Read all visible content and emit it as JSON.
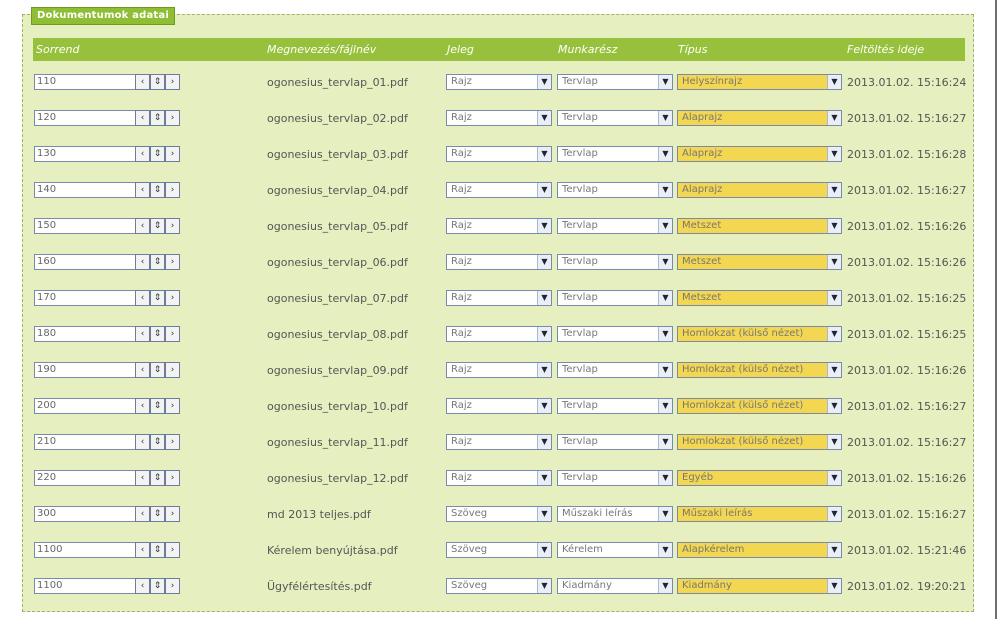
{
  "legend": "Dokumentumok adatai",
  "header": {
    "order": "Sorrend",
    "name": "Megnevezés/fájlnév",
    "mark": "Jeleg",
    "work": "Munkarész",
    "type": "Típus",
    "upload": "Feltöltés ideje"
  },
  "rows": [
    {
      "order": "110",
      "file": "ogonesius_tervlap_01.pdf",
      "mark": "Rajz",
      "work": "Tervlap",
      "type": "Helyszínrajz",
      "date": "2013.01.02. 15:16:24"
    },
    {
      "order": "120",
      "file": "ogonesius_tervlap_02.pdf",
      "mark": "Rajz",
      "work": "Tervlap",
      "type": "Alaprajz",
      "date": "2013.01.02. 15:16:27"
    },
    {
      "order": "130",
      "file": "ogonesius_tervlap_03.pdf",
      "mark": "Rajz",
      "work": "Tervlap",
      "type": "Alaprajz",
      "date": "2013.01.02. 15:16:28"
    },
    {
      "order": "140",
      "file": "ogonesius_tervlap_04.pdf",
      "mark": "Rajz",
      "work": "Tervlap",
      "type": "Alaprajz",
      "date": "2013.01.02. 15:16:27"
    },
    {
      "order": "150",
      "file": "ogonesius_tervlap_05.pdf",
      "mark": "Rajz",
      "work": "Tervlap",
      "type": "Metszet",
      "date": "2013.01.02. 15:16:26"
    },
    {
      "order": "160",
      "file": "ogonesius_tervlap_06.pdf",
      "mark": "Rajz",
      "work": "Tervlap",
      "type": "Metszet",
      "date": "2013.01.02. 15:16:26"
    },
    {
      "order": "170",
      "file": "ogonesius_tervlap_07.pdf",
      "mark": "Rajz",
      "work": "Tervlap",
      "type": "Metszet",
      "date": "2013.01.02. 15:16:25"
    },
    {
      "order": "180",
      "file": "ogonesius_tervlap_08.pdf",
      "mark": "Rajz",
      "work": "Tervlap",
      "type": "Homlokzat (külső nézet)",
      "date": "2013.01.02. 15:16:25"
    },
    {
      "order": "190",
      "file": "ogonesius_tervlap_09.pdf",
      "mark": "Rajz",
      "work": "Tervlap",
      "type": "Homlokzat (külső nézet)",
      "date": "2013.01.02. 15:16:26"
    },
    {
      "order": "200",
      "file": "ogonesius_tervlap_10.pdf",
      "mark": "Rajz",
      "work": "Tervlap",
      "type": "Homlokzat (külső nézet)",
      "date": "2013.01.02. 15:16:27"
    },
    {
      "order": "210",
      "file": "ogonesius_tervlap_11.pdf",
      "mark": "Rajz",
      "work": "Tervlap",
      "type": "Homlokzat (külső nézet)",
      "date": "2013.01.02. 15:16:27"
    },
    {
      "order": "220",
      "file": "ogonesius_tervlap_12.pdf",
      "mark": "Rajz",
      "work": "Tervlap",
      "type": "Egyéb",
      "date": "2013.01.02. 15:16:26"
    },
    {
      "order": "300",
      "file": "md 2013 teljes.pdf",
      "mark": "Szöveg",
      "work": "Műszaki leírás",
      "type": "Műszaki leírás",
      "date": "2013.01.02. 15:16:27"
    },
    {
      "order": "1100",
      "file": "Kérelem benyújtása.pdf",
      "mark": "Szöveg",
      "work": "Kérelem",
      "type": "Alapkérelem",
      "date": "2013.01.02. 15:21:46"
    },
    {
      "order": "1100",
      "file": "Ügyfélértesítés.pdf",
      "mark": "Szöveg",
      "work": "Kiadmány",
      "type": "Kiadmány",
      "date": "2013.01.02. 19:20:21"
    }
  ],
  "icons": {
    "spin_left": "‹",
    "spin_updown": "⇕",
    "spin_right": "›",
    "dropdown": "▼"
  },
  "colors": {
    "header_green": "#97c13c",
    "panel_bg": "#e6efc0",
    "type_yellow": "#f4d750"
  }
}
